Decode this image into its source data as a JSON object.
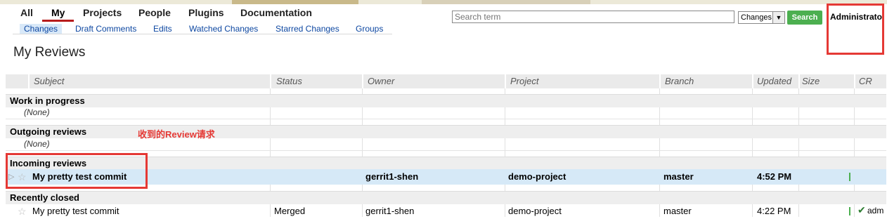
{
  "nav": {
    "top": [
      "All",
      "My",
      "Projects",
      "People",
      "Plugins",
      "Documentation"
    ],
    "active": "My",
    "sub": [
      "Changes",
      "Draft Comments",
      "Edits",
      "Watched Changes",
      "Starred Changes",
      "Groups"
    ]
  },
  "search": {
    "placeholder": "Search term",
    "scope": "Changes",
    "button": "Search"
  },
  "user": {
    "name": "Administrato"
  },
  "page": {
    "title": "My Reviews"
  },
  "table": {
    "columns": [
      "Subject",
      "Status",
      "Owner",
      "Project",
      "Branch",
      "Updated",
      "Size",
      "CR"
    ],
    "sections": [
      {
        "title": "Work in progress",
        "empty": "(None)"
      },
      {
        "title": "Outgoing reviews",
        "empty": "(None)"
      },
      {
        "title": "Incoming reviews",
        "rows": [
          {
            "subject": "My pretty test commit",
            "status": "",
            "owner": "gerrit1-shen",
            "project": "demo-project",
            "branch": "master",
            "updated": "4:52 PM"
          }
        ]
      },
      {
        "title": "Recently closed",
        "rows": [
          {
            "subject": "My pretty test commit",
            "status": "Merged",
            "owner": "gerrit1-shen",
            "project": "demo-project",
            "branch": "master",
            "updated": "4:22 PM",
            "cr": "adm"
          }
        ]
      }
    ]
  },
  "annotation": {
    "text": "收到的Review请求"
  },
  "colors": {
    "accent_red": "#e53935",
    "search_green": "#4caf50",
    "highlight": "#d6e9f7"
  },
  "icons": {
    "star": "star-icon",
    "check": "check-icon",
    "expand": "expand-arrow-icon"
  }
}
